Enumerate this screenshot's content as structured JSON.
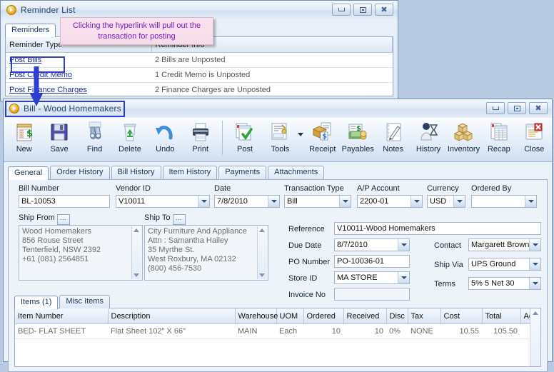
{
  "reminder_window": {
    "title": "Reminder List",
    "icon": "app-orb-icon",
    "window_buttons": [
      "minimize-icon",
      "maximize-icon",
      "close-icon"
    ],
    "tabs": [
      {
        "label": "Reminders",
        "active": true
      }
    ],
    "callout": {
      "line1": "Clicking the hyperlink will pull out the",
      "line2": "transaction for posting",
      "text_color": "#7719c9",
      "bg_color": "#f6dce9"
    },
    "grid": {
      "columns": [
        "Reminder Type",
        "Reminder Info"
      ],
      "rows": [
        {
          "type": "Post Bills",
          "info": "2 Bills are Unposted",
          "selected": true
        },
        {
          "type": "Post Credit Memo",
          "info": "1 Credit Memo is Unposted",
          "selected": false
        },
        {
          "type": "Post Finance Charges",
          "info": "2 Finance Charges are Unposted",
          "selected": false
        }
      ]
    },
    "highlight_color": "#2d3fd0"
  },
  "bill_window": {
    "title": "Bill - Wood Homemakers",
    "icon": "app-orb-icon",
    "window_buttons": [
      "minimize-icon",
      "maximize-icon",
      "close-icon"
    ],
    "toolbar": [
      {
        "label": "New",
        "icon": "new-document-icon"
      },
      {
        "label": "Save",
        "icon": "floppy-disk-icon"
      },
      {
        "label": "Find",
        "icon": "binoculars-icon"
      },
      {
        "label": "Delete",
        "icon": "recycle-bin-icon"
      },
      {
        "label": "Undo",
        "icon": "undo-arrow-icon"
      },
      {
        "label": "Print",
        "icon": "printer-icon"
      },
      {
        "label": "Post",
        "icon": "post-checkmark-icon"
      },
      {
        "label": "Tools",
        "icon": "tools-icon"
      },
      {
        "label": "Receipt",
        "icon": "receipt-box-icon"
      },
      {
        "label": "Payables",
        "icon": "payables-money-icon"
      },
      {
        "label": "Notes",
        "icon": "notepad-pen-icon"
      },
      {
        "label": "History",
        "icon": "history-hourglass-icon"
      },
      {
        "label": "Inventory",
        "icon": "inventory-boxes-icon"
      },
      {
        "label": "Recap",
        "icon": "recap-report-icon"
      },
      {
        "label": "Close",
        "icon": "close-window-icon"
      }
    ],
    "tabs": [
      {
        "label": "General",
        "active": true
      },
      {
        "label": "Order History",
        "active": false
      },
      {
        "label": "Bill History",
        "active": false
      },
      {
        "label": "Item History",
        "active": false
      },
      {
        "label": "Payments",
        "active": false
      },
      {
        "label": "Attachments",
        "active": false
      }
    ],
    "fields": {
      "bill_number": {
        "label": "Bill Number",
        "value": "BL-10053"
      },
      "vendor_id": {
        "label": "Vendor ID",
        "value": "V10011"
      },
      "date": {
        "label": "Date",
        "value": "7/8/2010"
      },
      "transaction_type": {
        "label": "Transaction Type",
        "value": "Bill"
      },
      "ap_account": {
        "label": "A/P Account",
        "value": "2200-01"
      },
      "currency": {
        "label": "Currency",
        "value": "USD"
      },
      "ordered_by": {
        "label": "Ordered By",
        "value": ""
      },
      "ship_from": {
        "label": "Ship From",
        "lines": [
          "Wood Homemakers",
          "856 Rouse Street",
          "Tenterfield, NSW 2392",
          "+61 (081) 2564851"
        ]
      },
      "ship_to": {
        "label": "Ship To",
        "lines": [
          "City Furniture And Appliance",
          "Attn : Samantha Hailey",
          "35 Myrthe St.",
          "West Roxbury, MA 02132",
          "(800) 456-7530"
        ]
      },
      "reference": {
        "label": "Reference",
        "value": "V10011-Wood Homemakers"
      },
      "due_date": {
        "label": "Due Date",
        "value": "8/7/2010"
      },
      "po_number": {
        "label": "PO Number",
        "value": "PO-10036-01"
      },
      "store_id": {
        "label": "Store ID",
        "value": "MA STORE"
      },
      "invoice_no": {
        "label": "Invoice No",
        "value": ""
      },
      "contact": {
        "label": "Contact",
        "value": "Margarett Brown"
      },
      "ship_via": {
        "label": "Ship Via",
        "value": "UPS Ground"
      },
      "terms": {
        "label": "Terms",
        "value": "5% 5 Net 30"
      }
    },
    "item_tabs": [
      {
        "label": "Items (1)",
        "active": true
      },
      {
        "label": "Misc Items",
        "active": false
      }
    ],
    "items_grid": {
      "columns": [
        "Item Number",
        "Description",
        "Warehouse",
        "UOM",
        "Ordered",
        "Received",
        "Disc",
        "Tax",
        "Cost",
        "Total",
        "Add"
      ],
      "rows": [
        {
          "item_number": "BED- FLAT SHEET",
          "description": "Flat Sheet 102\" X 66\"",
          "warehouse": "MAIN",
          "uom": "Each",
          "ordered": "10",
          "received": "10",
          "disc": "0%",
          "tax": "NONE",
          "cost": "10.55",
          "total": "105.50",
          "add": ""
        }
      ]
    },
    "highlight_color": "#2d3fd0"
  }
}
